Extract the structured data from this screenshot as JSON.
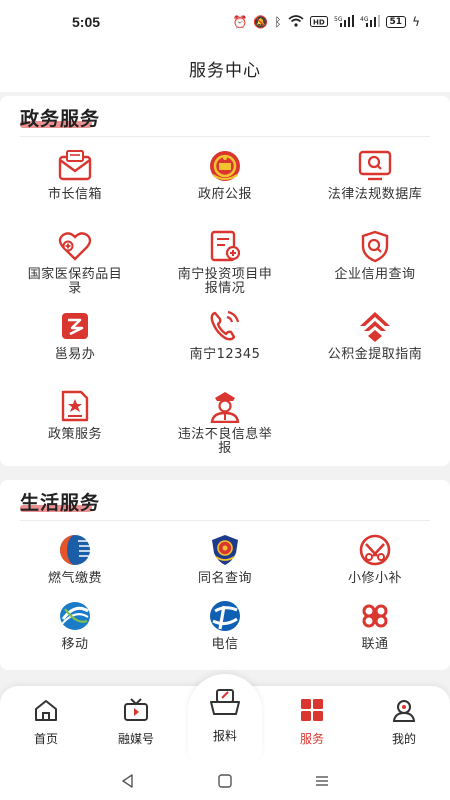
{
  "status": {
    "time": "5:05",
    "battery": "51"
  },
  "header": {
    "title": "服务中心"
  },
  "gov": {
    "title": "政务服务",
    "items": [
      {
        "label": "市长信箱",
        "icon": "mailbox-icon"
      },
      {
        "label": "政府公报",
        "icon": "national-emblem-icon"
      },
      {
        "label": "法律法规数据库",
        "icon": "monitor-search-icon"
      },
      {
        "label": "国家医保药品目录",
        "icon": "heart-plus-icon"
      },
      {
        "label": "南宁投资项目申报情况",
        "icon": "document-add-icon"
      },
      {
        "label": "企业信用查询",
        "icon": "credit-search-icon"
      },
      {
        "label": "邕易办",
        "icon": "yongyiban-logo-icon"
      },
      {
        "label": "南宁12345",
        "icon": "phone-call-icon"
      },
      {
        "label": "公积金提取指南",
        "icon": "housing-fund-logo-icon"
      },
      {
        "label": "政策服务",
        "icon": "policy-document-icon"
      },
      {
        "label": "违法不良信息举报",
        "icon": "police-officer-icon"
      }
    ]
  },
  "life": {
    "title": "生活服务",
    "items": [
      {
        "label": "燃气缴费",
        "icon": "gas-logo-icon"
      },
      {
        "label": "同名查询",
        "icon": "police-emblem-icon"
      },
      {
        "label": "小修小补",
        "icon": "repair-logo-icon"
      },
      {
        "label": "移动",
        "icon": "china-mobile-logo-icon"
      },
      {
        "label": "电信",
        "icon": "china-telecom-logo-icon"
      },
      {
        "label": "联通",
        "icon": "china-unicom-logo-icon"
      }
    ]
  },
  "nav": {
    "items": [
      {
        "label": "首页",
        "icon": "home-icon"
      },
      {
        "label": "融媒号",
        "icon": "tv-icon"
      },
      {
        "label": "报料",
        "icon": "report-icon"
      },
      {
        "label": "服务",
        "icon": "service-grid-icon"
      },
      {
        "label": "我的",
        "icon": "profile-icon"
      }
    ]
  },
  "colors": {
    "accent": "#d9362f",
    "background": "#f2f2f2"
  }
}
